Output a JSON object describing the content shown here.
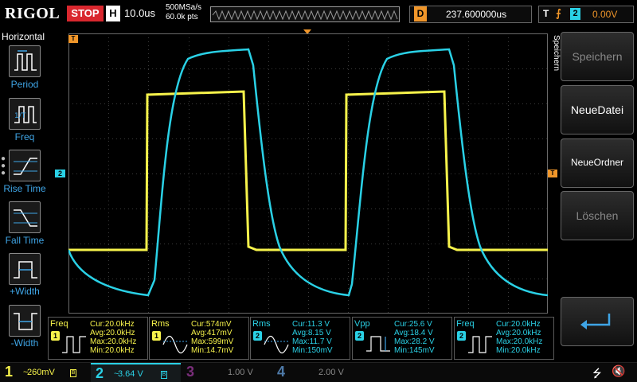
{
  "header": {
    "brand": "RIGOL",
    "run_state": "STOP",
    "timebase_mode": "H",
    "timebase": "10.0us",
    "sample_rate": "500MSa/s",
    "memory_depth": "60.0k pts",
    "delay_label": "D",
    "delay": "237.600000us",
    "trigger_label": "T",
    "trigger_edge": "⨍",
    "trigger_source": "2",
    "trigger_level": "0.00V"
  },
  "left_panel": {
    "title": "Horizontal",
    "items": [
      {
        "label": "Period",
        "icon": "period-icon"
      },
      {
        "label": "Freq",
        "icon": "freq-icon"
      },
      {
        "label": "Rise Time",
        "icon": "rise-time-icon"
      },
      {
        "label": "Fall Time",
        "icon": "fall-time-icon"
      },
      {
        "label": "+Width",
        "icon": "pos-width-icon"
      },
      {
        "label": "-Width",
        "icon": "neg-width-icon"
      }
    ]
  },
  "markers": {
    "trigger_pos": "T",
    "ch2_offset": "2",
    "trigger_level": "T"
  },
  "right_menu": {
    "title": "Speichern",
    "items": [
      {
        "label": "Speichern",
        "enabled": false
      },
      {
        "label": "NeueDatei",
        "enabled": true
      },
      {
        "label": "NeueOrdner",
        "enabled": true
      },
      {
        "label": "Löschen",
        "enabled": false
      }
    ],
    "return_icon": "return-arrow-icon"
  },
  "measurements": [
    {
      "name": "Freq",
      "channel": "1",
      "cur": "Cur:20.0kHz",
      "avg": "Avg:20.0kHz",
      "max": "Max:20.0kHz",
      "min": "Min:20.0kHz",
      "icon": "freq-icon"
    },
    {
      "name": "Rms",
      "channel": "1",
      "cur": "Cur:574mV",
      "avg": "Avg:417mV",
      "max": "Max:599mV",
      "min": "Min:14.7mV",
      "icon": "rms-icon"
    },
    {
      "name": "Rms",
      "channel": "2",
      "cur": "Cur:11.3 V",
      "avg": "Avg:8.15 V",
      "max": "Max:11.7 V",
      "min": "Min:150mV",
      "icon": "rms-icon"
    },
    {
      "name": "Vpp",
      "channel": "2",
      "cur": "Cur:25.6 V",
      "avg": "Avg:18.4 V",
      "max": "Max:28.2 V",
      "min": "Min:145mV",
      "icon": "vpp-icon"
    },
    {
      "name": "Freq",
      "channel": "2",
      "cur": "Cur:20.0kHz",
      "avg": "Avg:20.0kHz",
      "max": "Max:20.0kHz",
      "min": "Min:20.0kHz",
      "icon": "freq-icon"
    }
  ],
  "channels": [
    {
      "num": "1",
      "coupling": "~",
      "scale": "260mV",
      "bw": "B",
      "color": "#f7f34b"
    },
    {
      "num": "2",
      "coupling": "~",
      "scale": "3.64 V",
      "bw": "B",
      "color": "#2ad1e6"
    },
    {
      "num": "3",
      "coupling": "",
      "scale": "1.00 V",
      "bw": "",
      "color": "#7a2e7a"
    },
    {
      "num": "4",
      "coupling": "",
      "scale": "2.00 V",
      "bw": "",
      "color": "#4e7aa8"
    }
  ],
  "status_icons": [
    "usb-icon",
    "speaker-muted-icon"
  ],
  "colors": {
    "ch1": "#f7f34b",
    "ch2": "#2ad1e6",
    "accent": "#f0962a",
    "stop": "#d9272e"
  }
}
